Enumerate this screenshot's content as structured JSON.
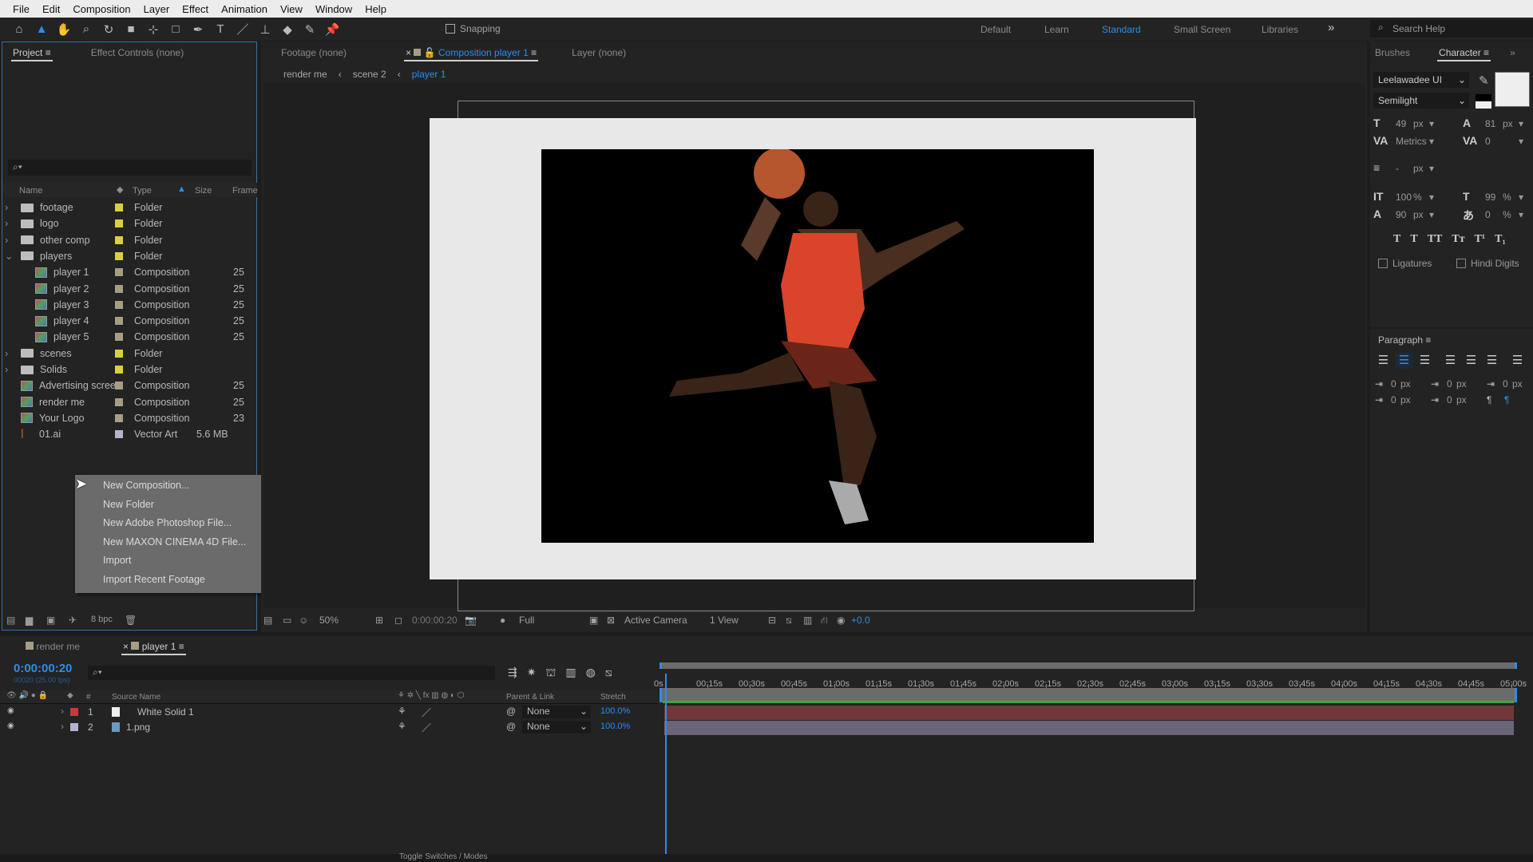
{
  "menu": [
    "File",
    "Edit",
    "Composition",
    "Layer",
    "Effect",
    "Animation",
    "View",
    "Window",
    "Help"
  ],
  "toolbar": {
    "tools": [
      "home-icon",
      "selection-tool-icon",
      "hand-tool-icon",
      "zoom-tool-icon",
      "rotate-tool-icon",
      "camera-tool-icon",
      "pan-behind-icon",
      "rectangle-tool-icon",
      "pen-tool-icon",
      "type-tool-icon",
      "brush-tool-icon",
      "clone-stamp-icon",
      "eraser-tool-icon",
      "roto-brush-icon",
      "puppet-pin-icon"
    ],
    "snapping": "Snapping",
    "workspaces": [
      "Default",
      "Learn",
      "Standard",
      "Small Screen",
      "Libraries"
    ],
    "active_workspace": "Standard",
    "search_placeholder": "Search Help"
  },
  "project": {
    "tabs": [
      "Project",
      "Effect Controls (none)"
    ],
    "columns": [
      "Name",
      "Type",
      "Size",
      "Frame"
    ],
    "items": [
      {
        "name": "footage",
        "type": "Folder",
        "size": "",
        "frame": "",
        "kind": "folder",
        "color": "#d9d13a",
        "indent": 0,
        "twirl": "›"
      },
      {
        "name": "logo",
        "type": "Folder",
        "size": "",
        "frame": "",
        "kind": "folder",
        "color": "#d9d13a",
        "indent": 0,
        "twirl": "›"
      },
      {
        "name": "other comp",
        "type": "Folder",
        "size": "",
        "frame": "",
        "kind": "folder",
        "color": "#d9d13a",
        "indent": 0,
        "twirl": "›"
      },
      {
        "name": "players",
        "type": "Folder",
        "size": "",
        "frame": "",
        "kind": "folder",
        "color": "#d9d13a",
        "indent": 0,
        "twirl": "⌄"
      },
      {
        "name": "player 1",
        "type": "Composition",
        "size": "",
        "frame": "25",
        "kind": "comp",
        "color": "#a69d85",
        "indent": 1,
        "twirl": ""
      },
      {
        "name": "player 2",
        "type": "Composition",
        "size": "",
        "frame": "25",
        "kind": "comp",
        "color": "#a69d85",
        "indent": 1,
        "twirl": ""
      },
      {
        "name": "player 3",
        "type": "Composition",
        "size": "",
        "frame": "25",
        "kind": "comp",
        "color": "#a69d85",
        "indent": 1,
        "twirl": ""
      },
      {
        "name": "player 4",
        "type": "Composition",
        "size": "",
        "frame": "25",
        "kind": "comp",
        "color": "#a69d85",
        "indent": 1,
        "twirl": ""
      },
      {
        "name": "player 5",
        "type": "Composition",
        "size": "",
        "frame": "25",
        "kind": "comp",
        "color": "#a69d85",
        "indent": 1,
        "twirl": ""
      },
      {
        "name": "scenes",
        "type": "Folder",
        "size": "",
        "frame": "",
        "kind": "folder",
        "color": "#d9d13a",
        "indent": 0,
        "twirl": "›"
      },
      {
        "name": "Solids",
        "type": "Folder",
        "size": "",
        "frame": "",
        "kind": "folder",
        "color": "#d9d13a",
        "indent": 0,
        "twirl": "›"
      },
      {
        "name": "Advertising screen",
        "type": "Composition",
        "size": "",
        "frame": "25",
        "kind": "comp",
        "color": "#a69d85",
        "indent": 0,
        "twirl": ""
      },
      {
        "name": "render me",
        "type": "Composition",
        "size": "",
        "frame": "25",
        "kind": "comp",
        "color": "#a69d85",
        "indent": 0,
        "twirl": ""
      },
      {
        "name": "Your Logo",
        "type": "Composition",
        "size": "",
        "frame": "23",
        "kind": "comp",
        "color": "#a69d85",
        "indent": 0,
        "twirl": ""
      },
      {
        "name": "01.ai",
        "type": "Vector Art",
        "size": "5.6 MB",
        "frame": "",
        "kind": "ai",
        "color": "#b4b4d0",
        "indent": 0,
        "twirl": ""
      }
    ],
    "bpc": "8 bpc"
  },
  "context_menu": [
    {
      "label": "New Composition...",
      "submenu": false
    },
    {
      "label": "New Folder",
      "submenu": false
    },
    {
      "label": "New Adobe Photoshop File...",
      "submenu": false
    },
    {
      "label": "New MAXON CINEMA 4D File...",
      "submenu": false
    },
    {
      "label": "Import",
      "submenu": true
    },
    {
      "label": "Import Recent Footage",
      "submenu": true
    }
  ],
  "viewer": {
    "tabs": [
      "Footage (none)",
      "Composition player 1",
      "Layer (none)"
    ],
    "breadcrumb": [
      "render me",
      "scene 2",
      "player 1"
    ],
    "zoom": "50%",
    "timecode": "0:00:00:20",
    "resolution": "Full",
    "camera": "Active Camera",
    "views": "1 View",
    "exposure": "+0.0"
  },
  "character": {
    "tabs": [
      "Brushes",
      "Character"
    ],
    "font": "Leelawadee UI",
    "style": "Semilight",
    "size": "49",
    "size_unit": "px",
    "leading": "81",
    "leading_unit": "px",
    "kerning": "Metrics",
    "tracking": "0",
    "stroke": "-",
    "stroke_unit": "px",
    "vscale": "100",
    "vscale_unit": "%",
    "hscale": "99",
    "hscale_unit": "%",
    "baseline": "90",
    "baseline_unit": "px",
    "tsume": "0",
    "tsume_unit": "%",
    "styles": [
      "T",
      "T",
      "TT",
      "Tт",
      "T¹",
      "T₁"
    ],
    "ligatures": "Ligatures",
    "hindi": "Hindi Digits",
    "fill_color": "#eeeeee"
  },
  "paragraph": {
    "title": "Paragraph",
    "indent_values": [
      "0",
      "0",
      "0",
      "0",
      "0"
    ],
    "unit": "px",
    "active_align": 1
  },
  "timeline": {
    "tabs": [
      "render me",
      "player 1"
    ],
    "timecode": "0:00:00:20",
    "frames": "00020 (25.00 fps)",
    "columns": [
      "#",
      "Source Name",
      "Parent & Link",
      "Stretch"
    ],
    "layers": [
      {
        "num": "1",
        "name": "White Solid 1",
        "color": "#c83a3a",
        "parent": "None",
        "stretch": "100.0%",
        "track": "#703838"
      },
      {
        "num": "2",
        "name": "1.png",
        "color": "#b8b0d0",
        "parent": "None",
        "stretch": "100.0%",
        "track": "#6a6578"
      }
    ],
    "ruler": [
      "0s",
      "00:15s",
      "00:30s",
      "00:45s",
      "01:00s",
      "01:15s",
      "01:30s",
      "01:45s",
      "02:00s",
      "02:15s",
      "02:30s",
      "02:45s",
      "03:00s",
      "03:15s",
      "03:30s",
      "03:45s",
      "04:00s",
      "04:15s",
      "04:30s",
      "04:45s",
      "05:00s"
    ],
    "toggle": "Toggle Switches / Modes"
  }
}
